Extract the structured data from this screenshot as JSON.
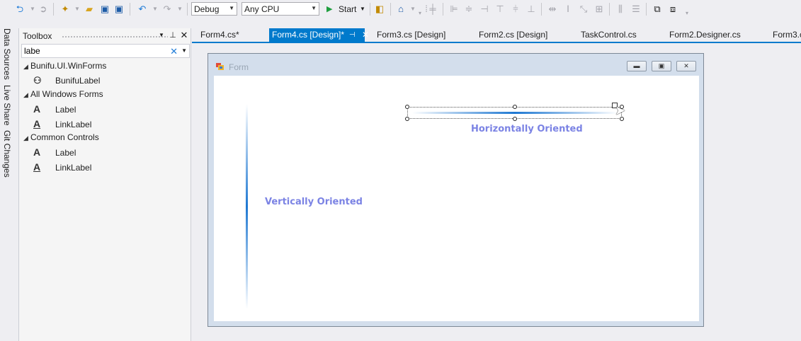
{
  "toolbar": {
    "config": "Debug",
    "platform": "Any CPU",
    "start_label": "Start"
  },
  "side_tabs": [
    "Data Sources",
    "Live Share",
    "Git Changes"
  ],
  "toolbox": {
    "title": "Toolbox",
    "search_value": "labe",
    "groups": [
      {
        "name": "Bunifu.UI.WinForms",
        "items": [
          "BunifuLabel"
        ]
      },
      {
        "name": "All Windows Forms",
        "items": [
          "Label",
          "LinkLabel"
        ]
      },
      {
        "name": "Common Controls",
        "items": [
          "Label",
          "LinkLabel"
        ]
      }
    ]
  },
  "tabs": [
    {
      "label": "Form4.cs*"
    },
    {
      "label": "Form4.cs [Design]*",
      "active": true
    },
    {
      "label": "Form3.cs [Design]"
    },
    {
      "label": "Form2.cs [Design]"
    },
    {
      "label": "TaskControl.cs"
    },
    {
      "label": "Form2.Designer.cs"
    },
    {
      "label": "Form3.c"
    }
  ],
  "form": {
    "title": "Form",
    "horizontal_label": "Horizontally Oriented",
    "vertical_label": "Vertically Oriented"
  },
  "colors": {
    "accent": "#007acc",
    "label_color": "#7b83e4",
    "separator_line": "#1e78d2"
  }
}
